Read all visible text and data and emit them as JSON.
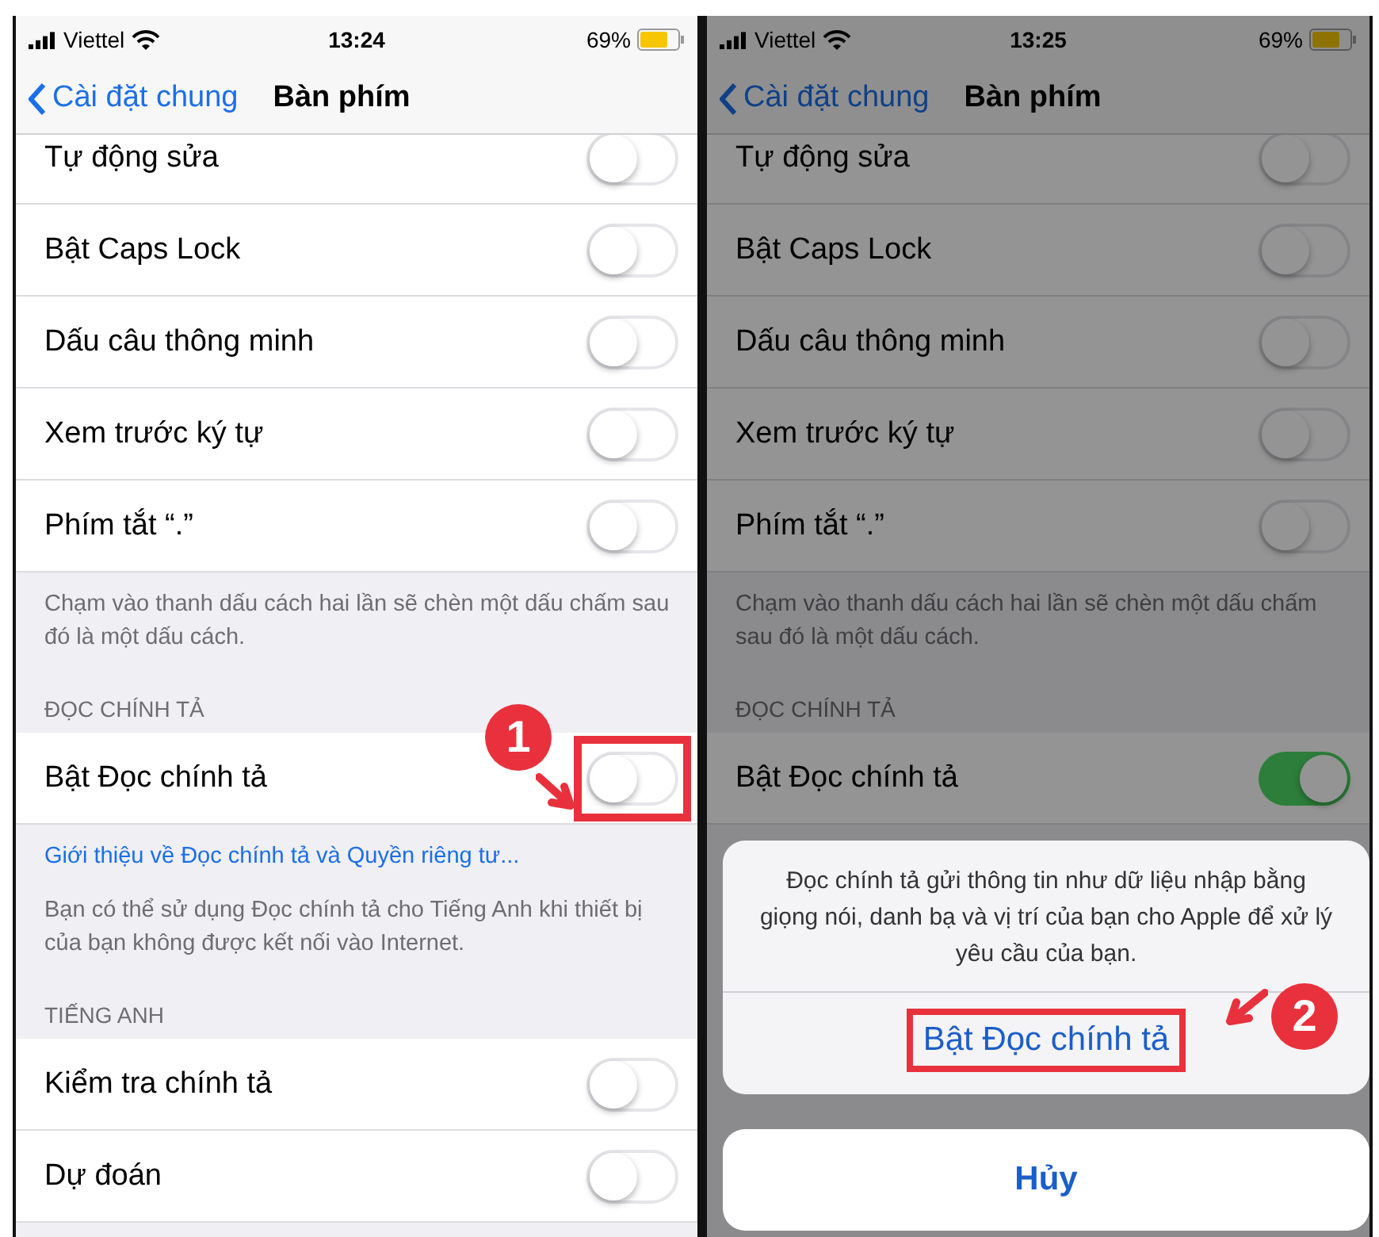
{
  "phones": [
    {
      "status": {
        "carrier": "Viettel",
        "time": "13:24",
        "battery": "69%"
      },
      "nav": {
        "back": "Cài đặt chung",
        "title": "Bàn phím"
      },
      "dimmed": false,
      "items": [
        {
          "kind": "row",
          "label": "Tự động sửa",
          "on": false
        },
        {
          "kind": "row",
          "label": "Bật Caps Lock",
          "on": false
        },
        {
          "kind": "row",
          "label": "Dấu câu thông minh",
          "on": false
        },
        {
          "kind": "row",
          "label": "Xem trước ký tự",
          "on": false
        },
        {
          "kind": "row",
          "label": "Phím tắt “.”",
          "on": false
        },
        {
          "kind": "footer",
          "text": "Chạm vào thanh dấu cách hai lần sẽ chèn một dấu chấm sau đó là một dấu cách."
        },
        {
          "kind": "header",
          "text": "ĐỌC CHÍNH TẢ"
        },
        {
          "kind": "row",
          "label": "Bật Đọc chính tả",
          "on": false,
          "callout": "1"
        },
        {
          "kind": "link",
          "text": "Giới thiệu về Đọc chính tả và Quyền riêng tư..."
        },
        {
          "kind": "footer",
          "text": "Bạn có thể sử dụng Đọc chính tả cho Tiếng Anh khi thiết bị của bạn không được kết nối vào Internet."
        },
        {
          "kind": "header",
          "text": "TIẾNG ANH"
        },
        {
          "kind": "row",
          "label": "Kiểm tra chính tả",
          "on": false
        },
        {
          "kind": "row",
          "label": "Dự đoán",
          "on": false
        }
      ]
    },
    {
      "status": {
        "carrier": "Viettel",
        "time": "13:25",
        "battery": "69%"
      },
      "nav": {
        "back": "Cài đặt chung",
        "title": "Bàn phím"
      },
      "dimmed": true,
      "items": [
        {
          "kind": "row",
          "label": "Tự động sửa",
          "on": false
        },
        {
          "kind": "row",
          "label": "Bật Caps Lock",
          "on": false
        },
        {
          "kind": "row",
          "label": "Dấu câu thông minh",
          "on": false
        },
        {
          "kind": "row",
          "label": "Xem trước ký tự",
          "on": false
        },
        {
          "kind": "row",
          "label": "Phím tắt “.”",
          "on": false
        },
        {
          "kind": "footer",
          "text": "Chạm vào thanh dấu cách hai lần sẽ chèn một dấu chấm sau đó là một dấu cách."
        },
        {
          "kind": "header",
          "text": "ĐỌC CHÍNH TẢ"
        },
        {
          "kind": "row",
          "label": "Bật Đọc chính tả",
          "on": true
        }
      ],
      "sheet": {
        "message": "Đọc chính tả gửi thông tin như dữ liệu nhập bằng giọng nói, danh bạ và vị trí của bạn cho Apple để xử lý yêu cầu của bạn.",
        "action": "Bật Đọc chính tả",
        "callout": "2",
        "cancel": "Hủy"
      }
    }
  ]
}
